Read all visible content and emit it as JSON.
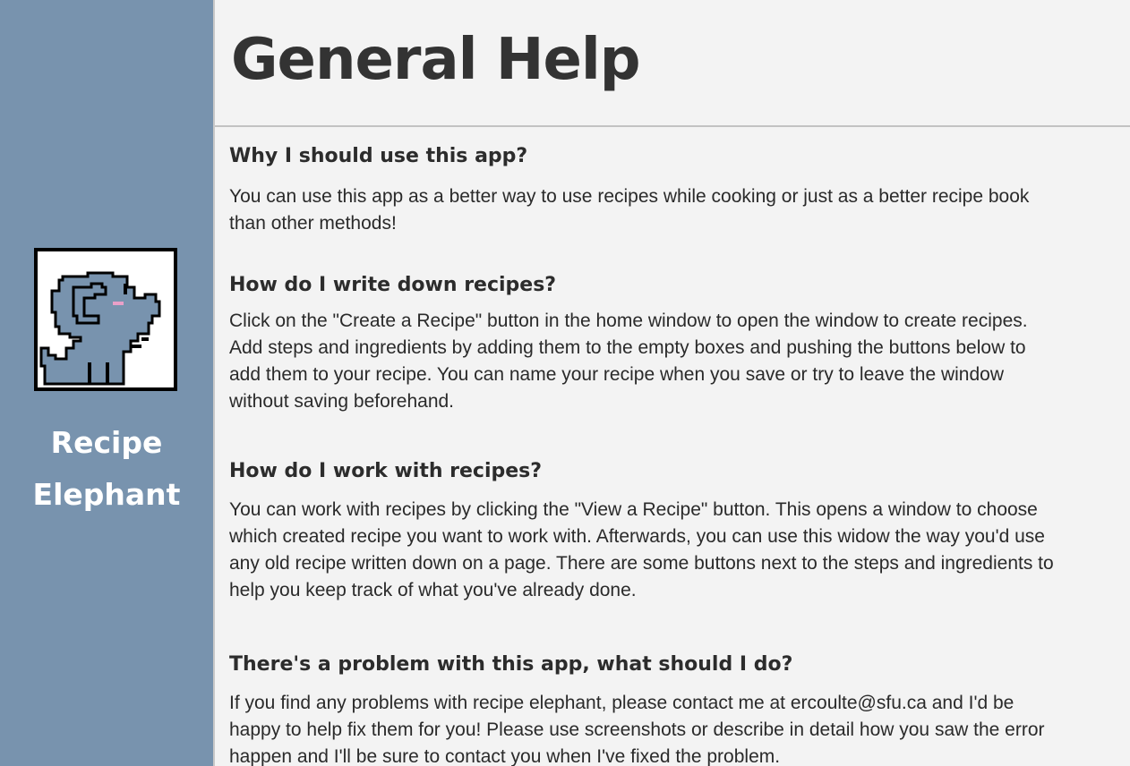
{
  "sidebar": {
    "logo_icon": "elephant-pixel-logo-icon",
    "brand_line1": "Recipe",
    "brand_line2": "Elephant",
    "background": "#7893ae"
  },
  "header": {
    "title": "General Help"
  },
  "faq": [
    {
      "question": "Why I should use this app?",
      "answer": "You can use this app as a better way to use recipes while cooking or just as a better recipe book than other methods!"
    },
    {
      "question": "How do I write down recipes?",
      "answer": "Click on the \"Create a Recipe\" button in the home window to open the window to create recipes. Add steps and ingredients by adding them to the empty boxes and pushing the buttons below to add them to your recipe. You can name your recipe when you save or try to leave the window without saving beforehand."
    },
    {
      "question": "How do I work with recipes?",
      "answer": "You can work with recipes by clicking the \"View a Recipe\" button. This opens a window to choose which created recipe you want to work with. Afterwards, you can use this widow the way you'd use any old recipe written down on a page. There are some buttons next to the steps and ingredients to help you keep track of what you've already done."
    },
    {
      "question": "There's a problem with this app, what should I do?",
      "answer": "If you find any problems with recipe elephant, please contact me at ercoulte@sfu.ca and I'd be happy to help fix them for you! Please use screenshots or describe in detail how you saw the error happen and I'll be sure to contact you when I've fixed the problem."
    }
  ]
}
